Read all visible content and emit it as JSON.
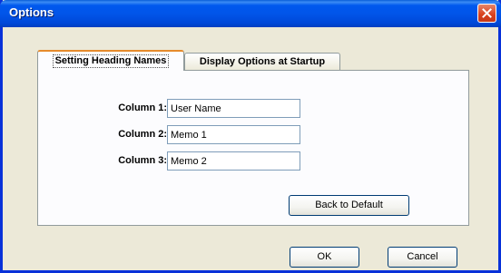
{
  "window": {
    "title": "Options"
  },
  "tabs": [
    {
      "label": "Setting Heading Names",
      "active": true
    },
    {
      "label": "Display Options at Startup",
      "active": false
    }
  ],
  "fields": [
    {
      "label": "Column 1:",
      "value": "User Name"
    },
    {
      "label": "Column 2:",
      "value": "Memo 1"
    },
    {
      "label": "Column 3:",
      "value": "Memo 2"
    }
  ],
  "buttons": {
    "back_to_default": "Back to Default",
    "ok": "OK",
    "cancel": "Cancel"
  },
  "colors": {
    "titlebar": "#0058ee",
    "close_button": "#d8401c",
    "dialog_face": "#ece9d8",
    "active_tab_highlight": "#e68b2c"
  },
  "icons": {
    "close": "close-icon"
  }
}
